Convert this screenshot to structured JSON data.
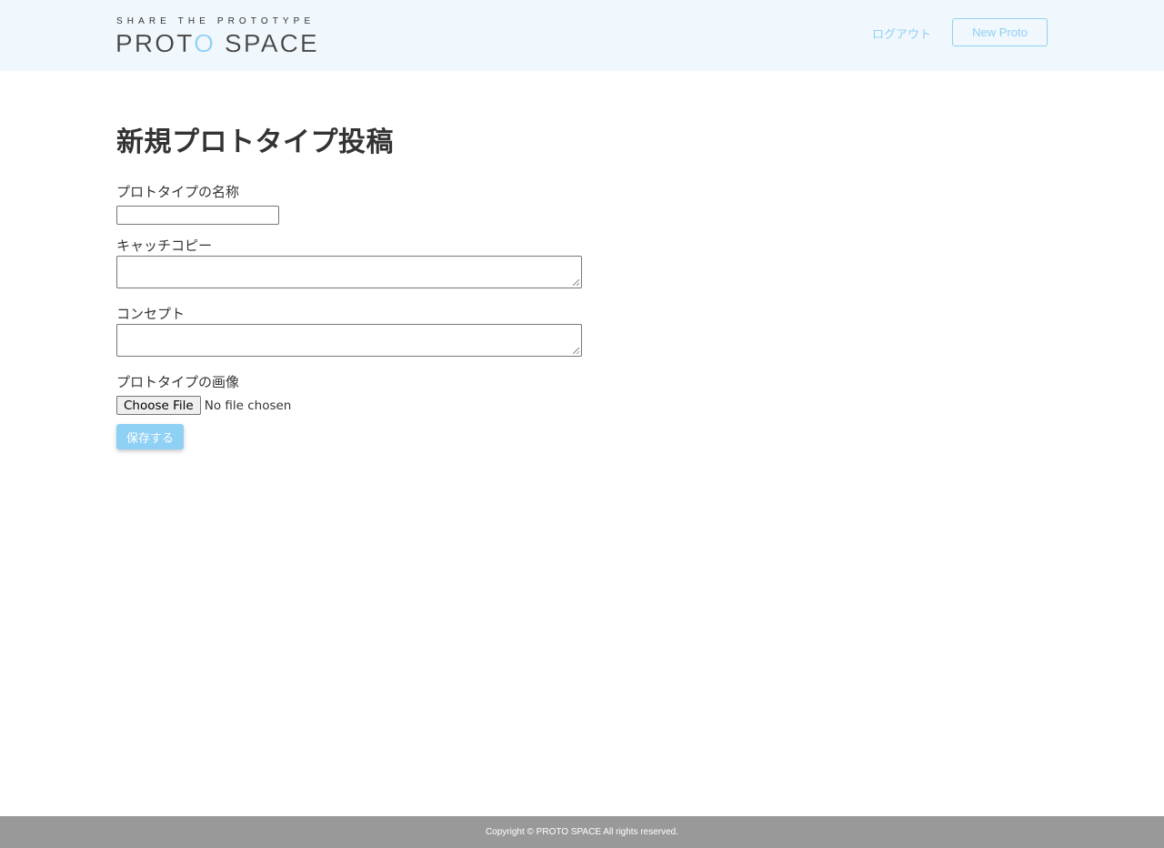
{
  "header": {
    "logo": {
      "tagline": "SHARE THE PROTOTYPE",
      "name_part1": "PROT",
      "name_accent": "O",
      "name_part2": " SPACE"
    },
    "nav": {
      "logout_label": "ログアウト",
      "new_proto_label": "New Proto"
    }
  },
  "main": {
    "title": "新規プロトタイプ投稿",
    "form": {
      "name_label": "プロトタイプの名称",
      "name_value": "",
      "catch_copy_label": "キャッチコピー",
      "catch_copy_value": "",
      "concept_label": "コンセプト",
      "concept_value": "",
      "image_label": "プロトタイプの画像",
      "file_button_label": "Choose File",
      "file_status": "No file chosen",
      "submit_label": "保存する"
    }
  },
  "footer": {
    "copyright": "Copyright © PROTO SPACE All rights reserved."
  },
  "colors": {
    "accent": "#8fd0f5",
    "header_bg": "#f0f7fd",
    "footer_bg": "#999999",
    "text": "#333333"
  },
  "icons": {
    "resize_grip": "resize-grip-icon"
  }
}
